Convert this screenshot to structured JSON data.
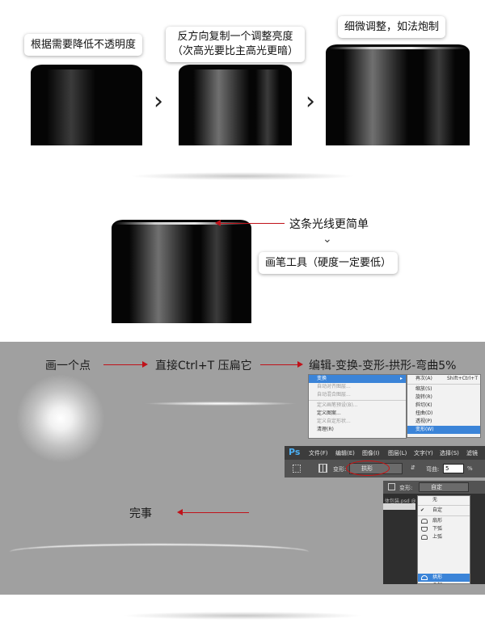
{
  "top": {
    "step1_label": "根据需要降低不透明度",
    "step2_label_line1": "反方向复制一个调整亮度",
    "step2_label_line2": "（次高光要比主高光更暗）",
    "step3_label": "细微调整，如法炮制",
    "chevron": "›"
  },
  "middle": {
    "note1": "这条光线更简单",
    "note2": "画笔工具（硬度一定要低）",
    "caret": "⌄"
  },
  "panel": {
    "step_dot": "画一个点",
    "step_press": "直接Ctrl+T 压扁它",
    "step_warp": "编辑-变换-变形-拱形-弯曲5%",
    "done": "完事",
    "menu_left": {
      "title": "变换",
      "items": [
        "自动对齐图层...",
        "自动混合图层...",
        "定义画笔预设(B)...",
        "定义图案...",
        "定义自定形状...",
        "清理(R)"
      ]
    },
    "menu_right": {
      "items": [
        "再次(A)",
        "缩放(S)",
        "旋转(R)",
        "斜切(K)",
        "扭曲(D)",
        "透视(P)",
        "变形(W)"
      ],
      "shortcut": "Shift+Ctrl+T"
    },
    "ps": {
      "logo": "Ps",
      "menus": [
        "文件(F)",
        "编辑(E)",
        "图像(I)",
        "图层(L)",
        "文字(Y)",
        "选择(S)",
        "滤镜"
      ],
      "warp_label": "变形:",
      "warp_value": "拱形",
      "bend_label": "弯曲:",
      "bend_value": "5",
      "percent": "%",
      "warp_label2": "变形:",
      "custom_value": "自定",
      "doc_tab": "体包装.psd @"
    },
    "warp_list": {
      "items": [
        "无",
        "自定",
        "扇形",
        "下弧",
        "上弧",
        "拱形",
        "凸起"
      ]
    }
  },
  "colors": {
    "panel_bg": "#a0a0a0",
    "arrow_red": "#c0121a",
    "selection_blue": "#3b84d8"
  }
}
